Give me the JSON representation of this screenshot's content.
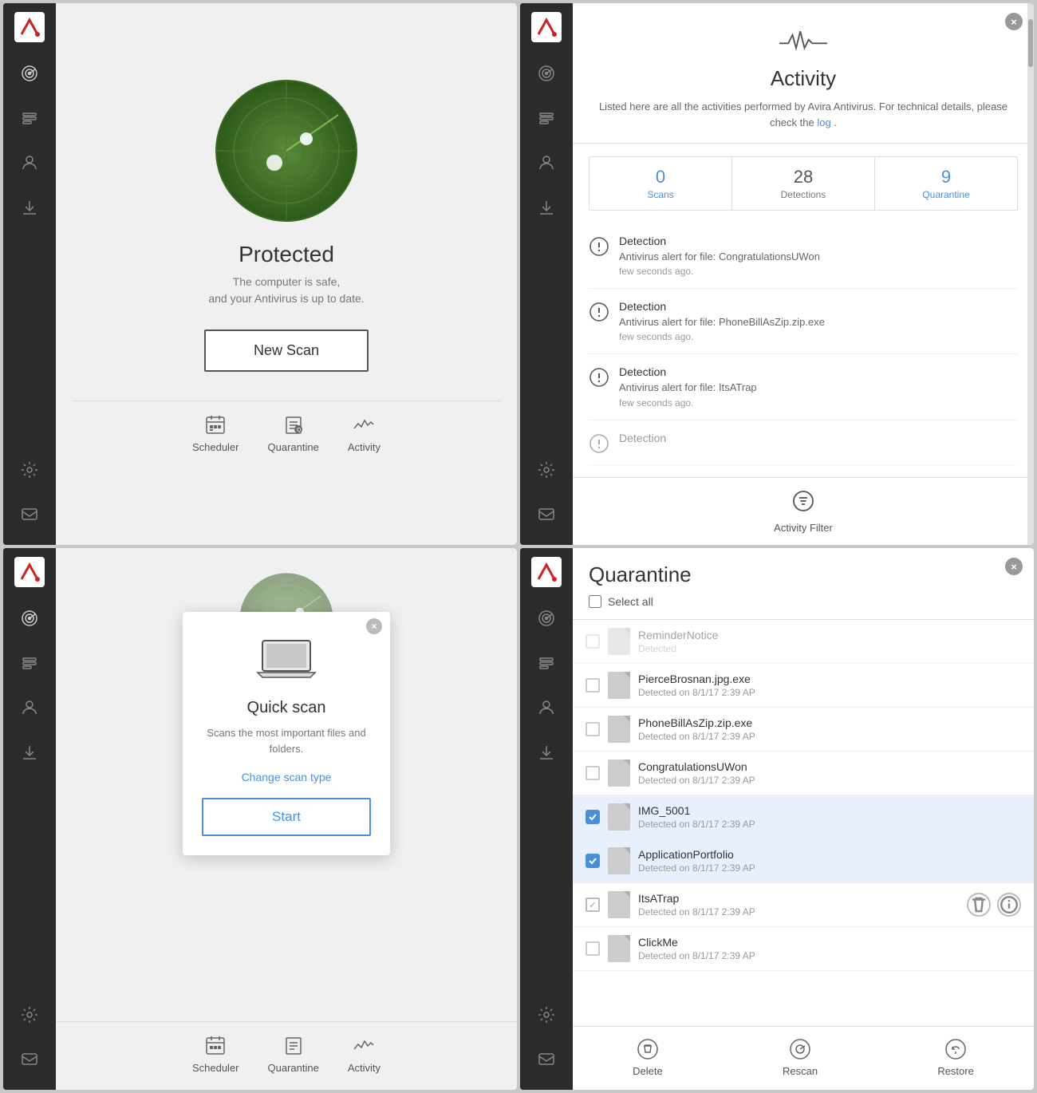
{
  "panels": {
    "protected": {
      "title": "Protected",
      "subtitle_line1": "The computer is safe,",
      "subtitle_line2": "and your Antivirus is up to date.",
      "new_scan_btn": "New Scan",
      "bottom_nav": [
        {
          "id": "scheduler",
          "label": "Scheduler"
        },
        {
          "id": "quarantine",
          "label": "Quarantine"
        },
        {
          "id": "activity",
          "label": "Activity"
        }
      ]
    },
    "activity": {
      "title": "Activity",
      "desc_prefix": "Listed here are all the activities performed by Avira Antivirus. For technical details, please check the ",
      "log_link": "log",
      "desc_suffix": ".",
      "close_btn": "×",
      "stats": [
        {
          "number": "0",
          "label": "Scans",
          "blue": true
        },
        {
          "number": "28",
          "label": "Detections",
          "blue": false
        },
        {
          "number": "9",
          "label": "Quarantine",
          "blue": true
        }
      ],
      "items": [
        {
          "title": "Detection",
          "desc": "Antivirus alert for file: CongratulationsUWon",
          "time": "few seconds ago."
        },
        {
          "title": "Detection",
          "desc": "Antivirus alert for file: PhoneBillAsZip.zip.exe",
          "time": "few seconds ago."
        },
        {
          "title": "Detection",
          "desc": "Antivirus alert for file: ItsATrap",
          "time": "few seconds ago."
        },
        {
          "title": "Detection",
          "desc": "",
          "time": ""
        }
      ],
      "filter_label": "Activity Filter"
    },
    "quick_scan": {
      "title": "Quick scan",
      "desc": "Scans the most important files and folders.",
      "change_link": "Change scan type",
      "start_btn": "Start",
      "close_btn": "×"
    },
    "quarantine": {
      "title": "Quarantine",
      "select_all": "Select all",
      "close_btn": "×",
      "items": [
        {
          "id": "reminder",
          "name": "ReminderNotice",
          "date": "Detected",
          "checked": false,
          "dimmed": true,
          "partial": false
        },
        {
          "id": "pierce",
          "name": "PierceBrosnan.jpg.exe",
          "date": "Detected on 8/1/17 2:39 AP",
          "checked": false,
          "dimmed": false,
          "partial": false
        },
        {
          "id": "phonebill",
          "name": "PhoneBillAsZip.zip.exe",
          "date": "Detected on 8/1/17 2:39 AP",
          "checked": false,
          "dimmed": false,
          "partial": false
        },
        {
          "id": "congrats",
          "name": "CongratulationsUWon",
          "date": "Detected on 8/1/17 2:39 AP",
          "checked": false,
          "dimmed": false,
          "partial": false
        },
        {
          "id": "img5001",
          "name": "IMG_5001",
          "date": "Detected on 8/1/17 2:39 AP",
          "checked": true,
          "dimmed": false,
          "partial": false
        },
        {
          "id": "appport",
          "name": "ApplicationPortfolio",
          "date": "Detected on 8/1/17 2:39 AP",
          "checked": true,
          "dimmed": false,
          "partial": false
        },
        {
          "id": "itstrap",
          "name": "ItsATrap",
          "date": "Detected on 8/1/17 2:39 AP",
          "checked": false,
          "dimmed": false,
          "partial": true,
          "show_actions": true
        },
        {
          "id": "clickme",
          "name": "ClickMe",
          "date": "Detected on 8/1/17 2:39 AP",
          "checked": false,
          "dimmed": false,
          "partial": false
        }
      ],
      "bottom_bar": [
        {
          "id": "delete",
          "label": "Delete"
        },
        {
          "id": "rescan",
          "label": "Rescan"
        },
        {
          "id": "restore",
          "label": "Restore"
        }
      ]
    }
  },
  "sidebar": {
    "nav_items": [
      "radar",
      "profile",
      "user",
      "download",
      "settings",
      "message"
    ]
  }
}
